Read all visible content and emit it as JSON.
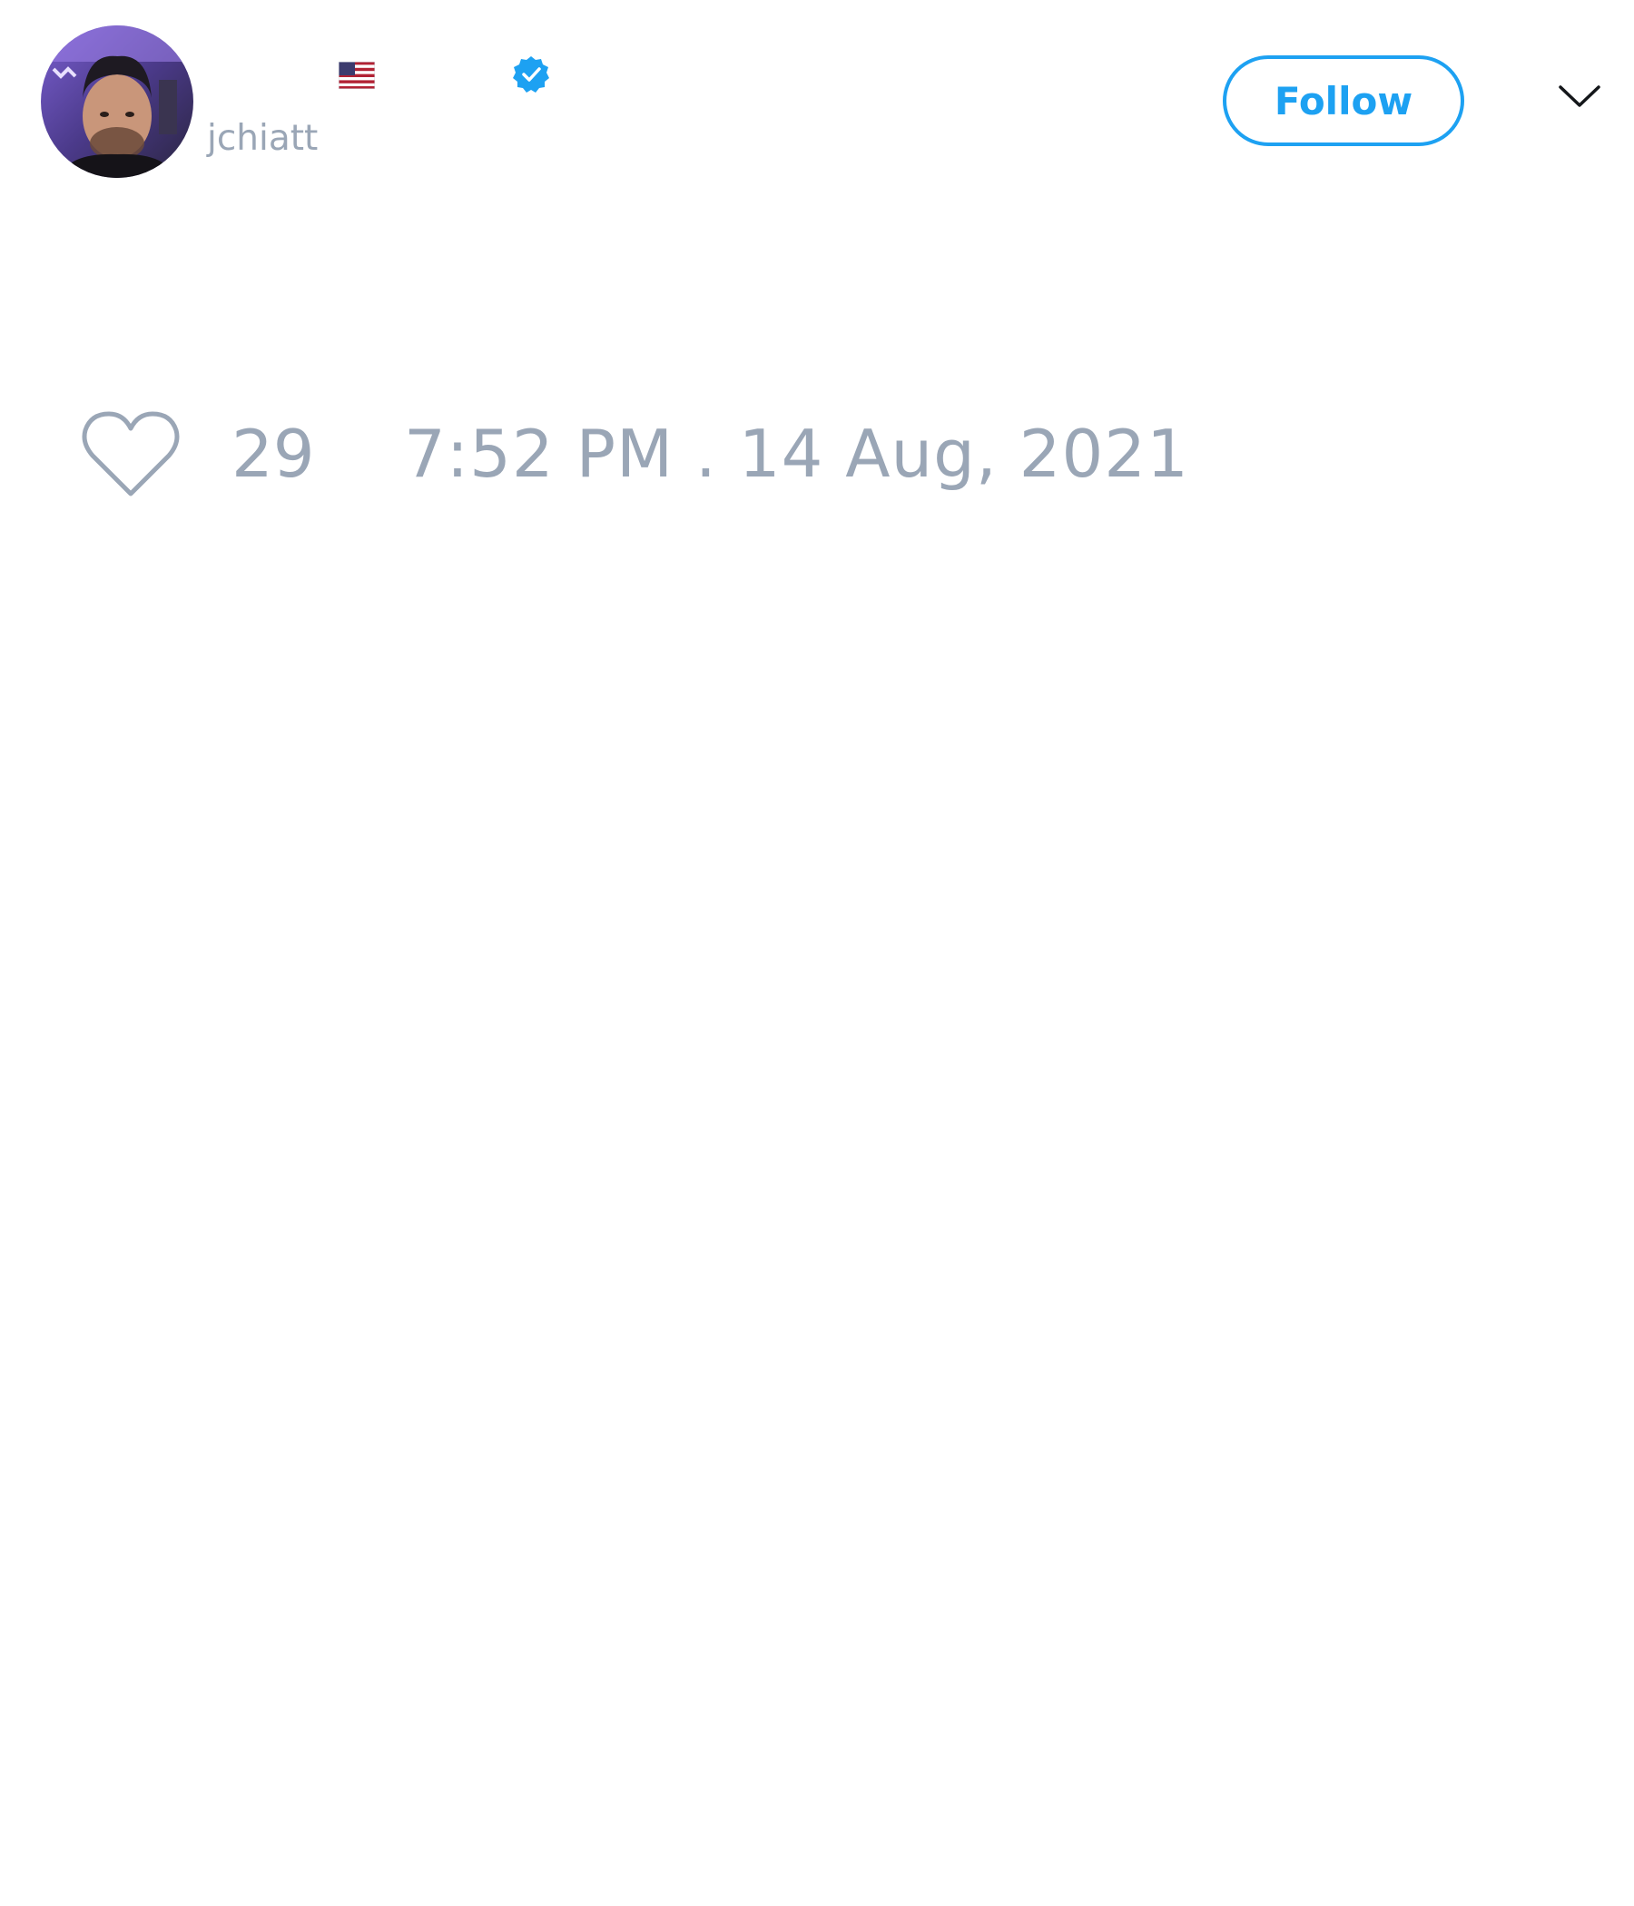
{
  "tweet": {
    "author": {
      "handle": "jchiatt",
      "flag_icon": "us-flag-icon",
      "verified_icon": "verified-badge-icon"
    },
    "follow_label": "Follow",
    "menu_icon": "chevron-down-icon",
    "like_icon": "heart-icon",
    "like_count": "29",
    "timestamp": "7:52 PM . 14 Aug, 2021"
  },
  "colors": {
    "accent": "#1da1f2",
    "muted_text": "#9aa6b6",
    "background": "#ffffff"
  }
}
